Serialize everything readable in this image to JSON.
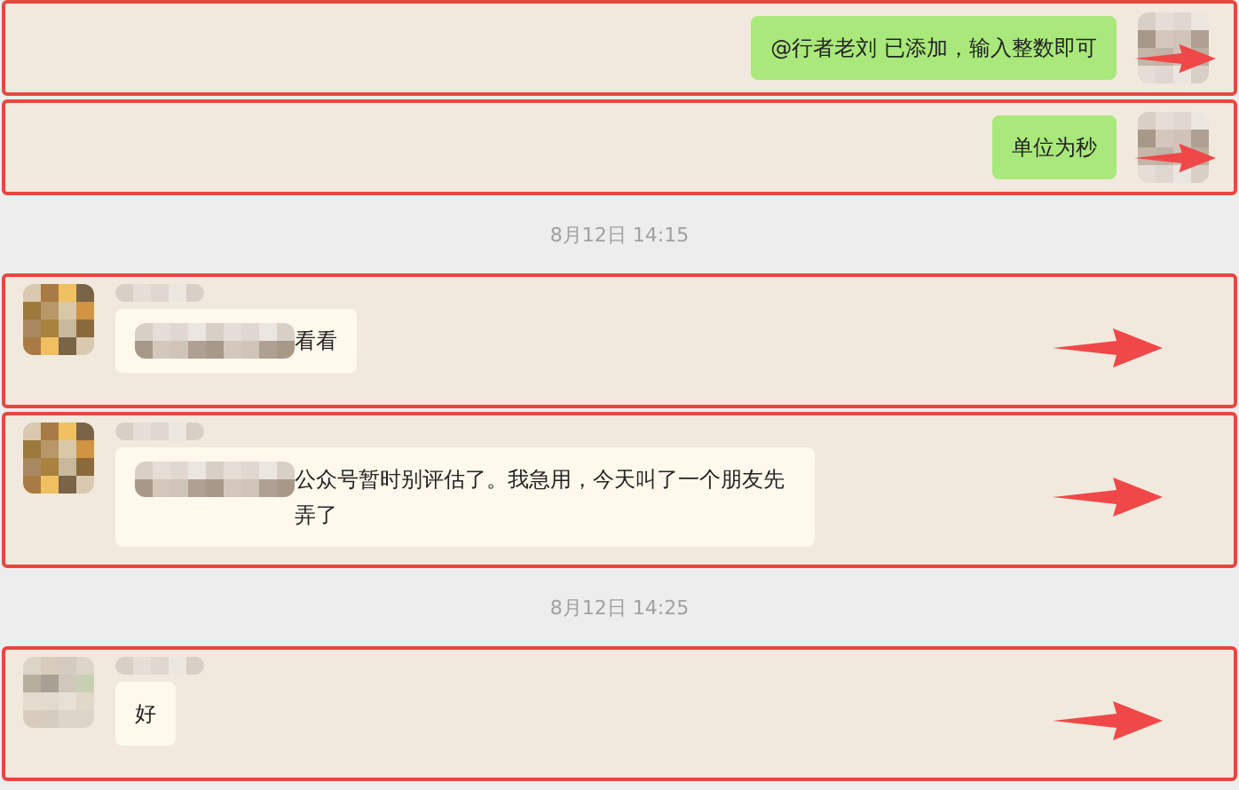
{
  "messages": [
    {
      "kind": "outgoing",
      "text": "@行者老刘 已添加，输入整数即可",
      "redacted_prefix": false
    },
    {
      "kind": "outgoing",
      "text": "单位为秒",
      "redacted_prefix": false
    },
    {
      "kind": "time",
      "text": "8月12日 14:15"
    },
    {
      "kind": "incoming",
      "text": "看看",
      "redacted_prefix": true
    },
    {
      "kind": "incoming",
      "text": "公众号暂时别评估了。我急用，今天叫了一个朋友先弄了",
      "redacted_prefix": true
    },
    {
      "kind": "time",
      "text": "8月12日 14:25"
    },
    {
      "kind": "incoming",
      "text": "好",
      "redacted_prefix": false
    }
  ]
}
